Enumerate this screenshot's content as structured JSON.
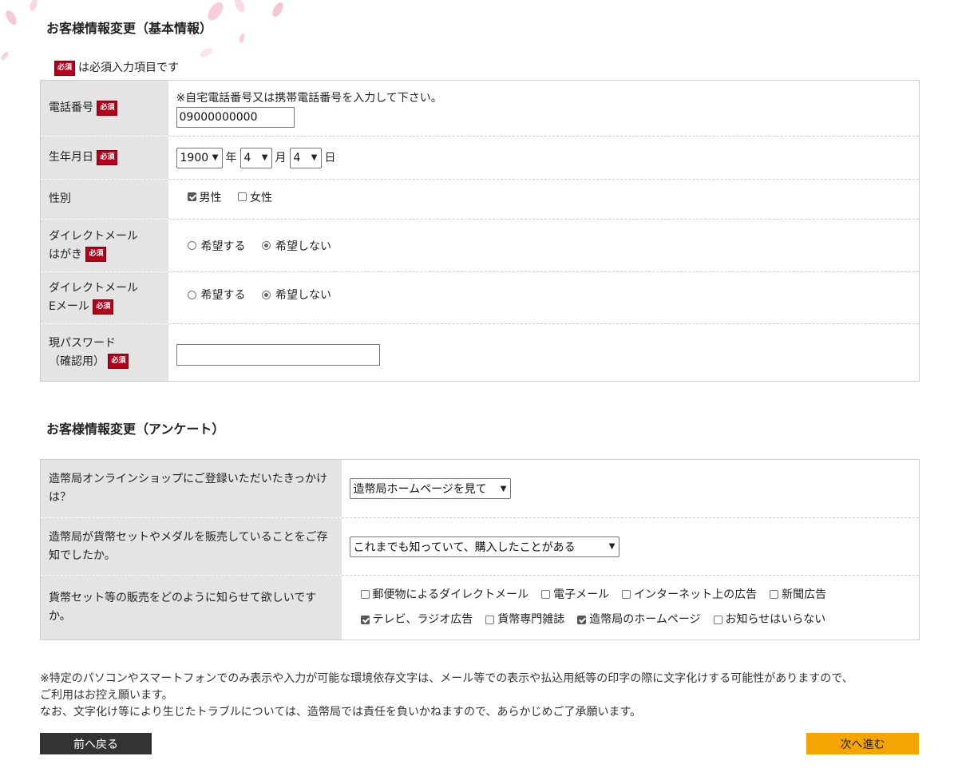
{
  "section1": {
    "title": "お客様情報変更（基本情報）",
    "required_badge": "必須",
    "legend_text": "は必須入力項目です",
    "phone": {
      "label": "電話番号",
      "note": "※自宅電話番号又は携帯電話番号を入力して下さい。",
      "value": "09000000000"
    },
    "birthdate": {
      "label": "生年月日",
      "year": "1900",
      "year_unit": "年",
      "month": "4",
      "month_unit": "月",
      "day": "4",
      "day_unit": "日"
    },
    "gender": {
      "label": "性別",
      "options": [
        {
          "label": "男性",
          "checked": true
        },
        {
          "label": "女性",
          "checked": false
        }
      ]
    },
    "dm_postcard": {
      "label_line1": "ダイレクトメール",
      "label_line2": "はがき",
      "options": [
        {
          "label": "希望する",
          "checked": false
        },
        {
          "label": "希望しない",
          "checked": true
        }
      ]
    },
    "dm_email": {
      "label_line1": "ダイレクトメール",
      "label_line2": "Eメール",
      "options": [
        {
          "label": "希望する",
          "checked": false
        },
        {
          "label": "希望しない",
          "checked": true
        }
      ]
    },
    "password": {
      "label_line1": "現パスワード",
      "label_line2": "（確認用）",
      "value": ""
    }
  },
  "section2": {
    "title": "お客様情報変更（アンケート）",
    "q1": {
      "label": "造幣局オンラインショップにご登録いただいたきっかけは？",
      "selected": "造幣局ホームページを見て"
    },
    "q2": {
      "label": "造幣局が貨幣セットやメダルを販売していることをご存知でしたか。",
      "selected": "これまでも知っていて、購入したことがある"
    },
    "q3": {
      "label": "貨幣セット等の販売をどのように知らせて欲しいですか。",
      "options_row1": [
        {
          "label": "郵便物によるダイレクトメール",
          "checked": false
        },
        {
          "label": "電子メール",
          "checked": false
        },
        {
          "label": "インターネット上の広告",
          "checked": false
        },
        {
          "label": "新聞広告",
          "checked": false
        }
      ],
      "options_row2": [
        {
          "label": "テレビ、ラジオ広告",
          "checked": true
        },
        {
          "label": "貨幣専門雑誌",
          "checked": false
        },
        {
          "label": "造幣局のホームページ",
          "checked": true
        },
        {
          "label": "お知らせはいらない",
          "checked": false
        }
      ]
    }
  },
  "notes": {
    "line1": "※特定のパソコンやスマートフォンでのみ表示や入力が可能な環境依存文字は、メール等での表示や払込用紙等の印字の際に文字化けする可能性がありますので、",
    "line2": "ご利用はお控え願います。",
    "line3": "なお、文字化け等により生じたトラブルについては、造幣局では責任を負いかねますので、あらかじめご了承願います。"
  },
  "buttons": {
    "back": "前へ戻る",
    "next": "次へ進む"
  },
  "colors": {
    "required_badge": "#b3001b",
    "next_button": "#f5a500",
    "back_button": "#333333",
    "label_cell": "#e4e4e4"
  }
}
